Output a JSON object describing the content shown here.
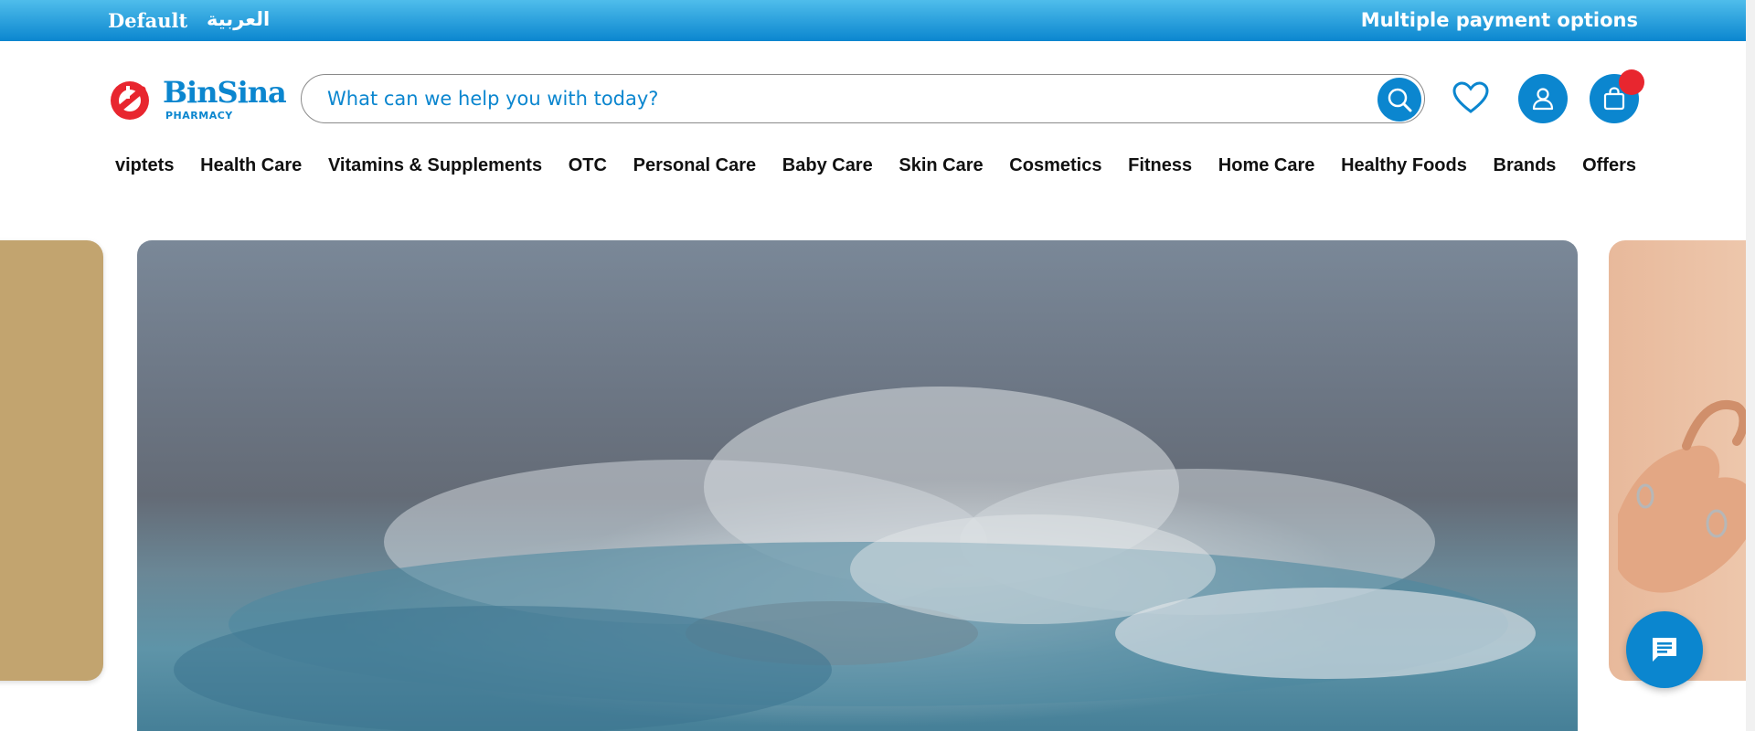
{
  "topbar": {
    "lang_default": "Default",
    "lang_arabic": "العربية",
    "promo_text": "Multiple payment options"
  },
  "header": {
    "logo_name": "BinSina",
    "logo_sub": "PHARMACY",
    "search_placeholder": "What can we help you with today?",
    "icons": [
      "search-icon",
      "heart-icon",
      "user-icon",
      "shopping-bag-icon"
    ],
    "colors": {
      "brand_blue": "#0b86cf",
      "brand_red": "#e8262f"
    }
  },
  "nav": {
    "items": [
      "viptets",
      "Health Care",
      "Vitamins & Supplements",
      "OTC",
      "Personal Care",
      "Baby Care",
      "Skin Care",
      "Cosmetics",
      "Fitness",
      "Home Care",
      "Healthy Foods",
      "Brands",
      "Offers"
    ]
  },
  "chat": {
    "icon": "chat-icon"
  }
}
